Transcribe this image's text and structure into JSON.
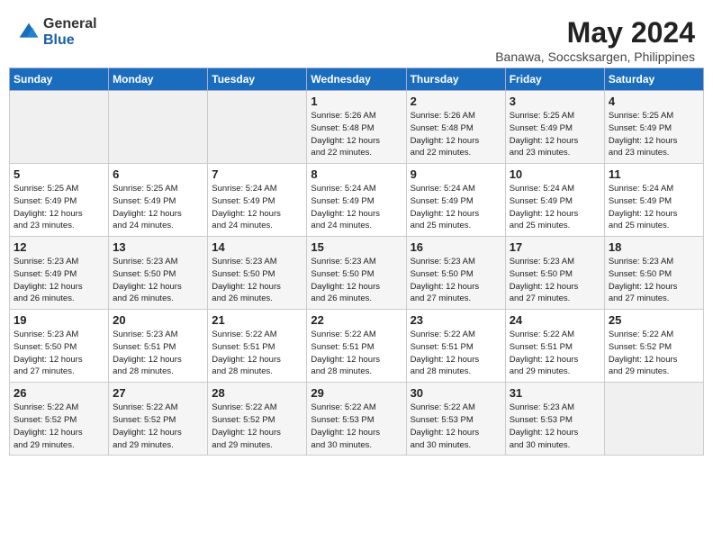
{
  "header": {
    "logo_general": "General",
    "logo_blue": "Blue",
    "title": "May 2024",
    "subtitle": "Banawa, Soccsksargen, Philippines"
  },
  "days_of_week": [
    "Sunday",
    "Monday",
    "Tuesday",
    "Wednesday",
    "Thursday",
    "Friday",
    "Saturday"
  ],
  "weeks": [
    [
      {
        "day": "",
        "info": ""
      },
      {
        "day": "",
        "info": ""
      },
      {
        "day": "",
        "info": ""
      },
      {
        "day": "1",
        "info": "Sunrise: 5:26 AM\nSunset: 5:48 PM\nDaylight: 12 hours\nand 22 minutes."
      },
      {
        "day": "2",
        "info": "Sunrise: 5:26 AM\nSunset: 5:48 PM\nDaylight: 12 hours\nand 22 minutes."
      },
      {
        "day": "3",
        "info": "Sunrise: 5:25 AM\nSunset: 5:49 PM\nDaylight: 12 hours\nand 23 minutes."
      },
      {
        "day": "4",
        "info": "Sunrise: 5:25 AM\nSunset: 5:49 PM\nDaylight: 12 hours\nand 23 minutes."
      }
    ],
    [
      {
        "day": "5",
        "info": "Sunrise: 5:25 AM\nSunset: 5:49 PM\nDaylight: 12 hours\nand 23 minutes."
      },
      {
        "day": "6",
        "info": "Sunrise: 5:25 AM\nSunset: 5:49 PM\nDaylight: 12 hours\nand 24 minutes."
      },
      {
        "day": "7",
        "info": "Sunrise: 5:24 AM\nSunset: 5:49 PM\nDaylight: 12 hours\nand 24 minutes."
      },
      {
        "day": "8",
        "info": "Sunrise: 5:24 AM\nSunset: 5:49 PM\nDaylight: 12 hours\nand 24 minutes."
      },
      {
        "day": "9",
        "info": "Sunrise: 5:24 AM\nSunset: 5:49 PM\nDaylight: 12 hours\nand 25 minutes."
      },
      {
        "day": "10",
        "info": "Sunrise: 5:24 AM\nSunset: 5:49 PM\nDaylight: 12 hours\nand 25 minutes."
      },
      {
        "day": "11",
        "info": "Sunrise: 5:24 AM\nSunset: 5:49 PM\nDaylight: 12 hours\nand 25 minutes."
      }
    ],
    [
      {
        "day": "12",
        "info": "Sunrise: 5:23 AM\nSunset: 5:49 PM\nDaylight: 12 hours\nand 26 minutes."
      },
      {
        "day": "13",
        "info": "Sunrise: 5:23 AM\nSunset: 5:50 PM\nDaylight: 12 hours\nand 26 minutes."
      },
      {
        "day": "14",
        "info": "Sunrise: 5:23 AM\nSunset: 5:50 PM\nDaylight: 12 hours\nand 26 minutes."
      },
      {
        "day": "15",
        "info": "Sunrise: 5:23 AM\nSunset: 5:50 PM\nDaylight: 12 hours\nand 26 minutes."
      },
      {
        "day": "16",
        "info": "Sunrise: 5:23 AM\nSunset: 5:50 PM\nDaylight: 12 hours\nand 27 minutes."
      },
      {
        "day": "17",
        "info": "Sunrise: 5:23 AM\nSunset: 5:50 PM\nDaylight: 12 hours\nand 27 minutes."
      },
      {
        "day": "18",
        "info": "Sunrise: 5:23 AM\nSunset: 5:50 PM\nDaylight: 12 hours\nand 27 minutes."
      }
    ],
    [
      {
        "day": "19",
        "info": "Sunrise: 5:23 AM\nSunset: 5:50 PM\nDaylight: 12 hours\nand 27 minutes."
      },
      {
        "day": "20",
        "info": "Sunrise: 5:23 AM\nSunset: 5:51 PM\nDaylight: 12 hours\nand 28 minutes."
      },
      {
        "day": "21",
        "info": "Sunrise: 5:22 AM\nSunset: 5:51 PM\nDaylight: 12 hours\nand 28 minutes."
      },
      {
        "day": "22",
        "info": "Sunrise: 5:22 AM\nSunset: 5:51 PM\nDaylight: 12 hours\nand 28 minutes."
      },
      {
        "day": "23",
        "info": "Sunrise: 5:22 AM\nSunset: 5:51 PM\nDaylight: 12 hours\nand 28 minutes."
      },
      {
        "day": "24",
        "info": "Sunrise: 5:22 AM\nSunset: 5:51 PM\nDaylight: 12 hours\nand 29 minutes."
      },
      {
        "day": "25",
        "info": "Sunrise: 5:22 AM\nSunset: 5:52 PM\nDaylight: 12 hours\nand 29 minutes."
      }
    ],
    [
      {
        "day": "26",
        "info": "Sunrise: 5:22 AM\nSunset: 5:52 PM\nDaylight: 12 hours\nand 29 minutes."
      },
      {
        "day": "27",
        "info": "Sunrise: 5:22 AM\nSunset: 5:52 PM\nDaylight: 12 hours\nand 29 minutes."
      },
      {
        "day": "28",
        "info": "Sunrise: 5:22 AM\nSunset: 5:52 PM\nDaylight: 12 hours\nand 29 minutes."
      },
      {
        "day": "29",
        "info": "Sunrise: 5:22 AM\nSunset: 5:53 PM\nDaylight: 12 hours\nand 30 minutes."
      },
      {
        "day": "30",
        "info": "Sunrise: 5:22 AM\nSunset: 5:53 PM\nDaylight: 12 hours\nand 30 minutes."
      },
      {
        "day": "31",
        "info": "Sunrise: 5:23 AM\nSunset: 5:53 PM\nDaylight: 12 hours\nand 30 minutes."
      },
      {
        "day": "",
        "info": ""
      }
    ]
  ]
}
